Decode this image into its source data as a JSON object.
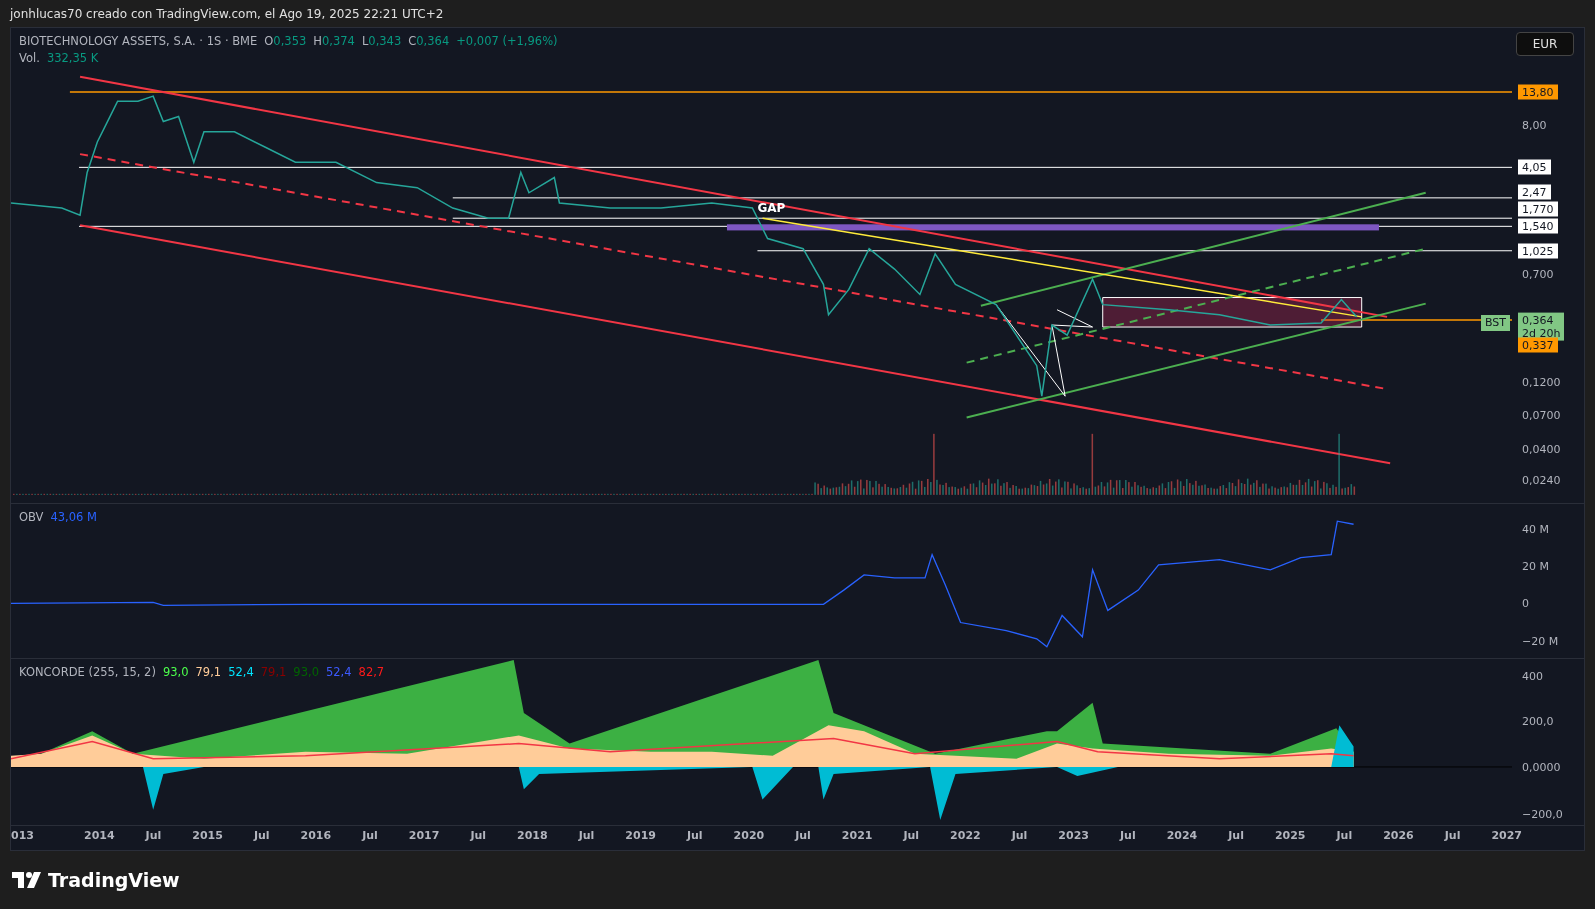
{
  "top_bar": {
    "author_line": "jonhlucas70 creado con TradingView.com, el Ago 19, 2025 22:21 UTC+2"
  },
  "legend": {
    "symbol": "BIOTECHNOLOGY ASSETS, S.A. · 1S · BME",
    "ohlc": [
      {
        "label": "O",
        "value": "0,353"
      },
      {
        "label": "H",
        "value": "0,374"
      },
      {
        "label": "L",
        "value": "0,343"
      },
      {
        "label": "C",
        "value": "0,364"
      }
    ],
    "change": "+0,007 (+1,96%)",
    "volume_label": "Vol.",
    "volume_value": "332,35 K"
  },
  "currency_button": "EUR",
  "annotation": "GAP",
  "price_axis": [
    {
      "kind": "alert",
      "text": "13,80"
    },
    {
      "kind": "tick",
      "text": "8,00"
    },
    {
      "kind": "line",
      "text": "4,05"
    },
    {
      "kind": "line",
      "text": "2,47"
    },
    {
      "kind": "line",
      "text": "1,770"
    },
    {
      "kind": "line",
      "text": "1,540"
    },
    {
      "kind": "line",
      "text": "1,025"
    },
    {
      "kind": "tick",
      "text": "0,700"
    },
    {
      "kind": "price",
      "tag": "BST",
      "text": "0,364",
      "countdown": "2d 20h"
    },
    {
      "kind": "alert",
      "text": "0,337"
    },
    {
      "kind": "tick",
      "text": "0,1200"
    },
    {
      "kind": "tick",
      "text": "0,0700"
    },
    {
      "kind": "tick",
      "text": "0,0400"
    },
    {
      "kind": "tick",
      "text": "0,0240"
    }
  ],
  "obv": {
    "name": "OBV",
    "value": "43,06 M",
    "axis": [
      "40 M",
      "20 M",
      "0",
      "−20 M"
    ]
  },
  "koncorde": {
    "name": "KONCORDE (255, 15, 2)",
    "values": [
      {
        "text": "93,0",
        "color": "#4cff4c"
      },
      {
        "text": "79,1",
        "color": "#ffcc99"
      },
      {
        "text": "52,4",
        "color": "#00e5ff"
      },
      {
        "text": "79,1",
        "color": "#8b0000"
      },
      {
        "text": "93,0",
        "color": "#006400"
      },
      {
        "text": "52,4",
        "color": "#3d5afe"
      },
      {
        "text": "82,7",
        "color": "#ff1a1a"
      }
    ],
    "axis": [
      "400",
      "200,0",
      "0,0000",
      "−200,0"
    ]
  },
  "time_axis": [
    "013",
    "2014",
    "Jul",
    "2015",
    "Jul",
    "2016",
    "Jul",
    "2017",
    "Jul",
    "2018",
    "Jul",
    "2019",
    "Jul",
    "2020",
    "Jul",
    "2021",
    "Jul",
    "2022",
    "Jul",
    "2023",
    "Jul",
    "2024",
    "Jul",
    "2025",
    "Jul",
    "2026",
    "Jul",
    "2027"
  ],
  "footer": {
    "brand": "TradingView"
  }
}
